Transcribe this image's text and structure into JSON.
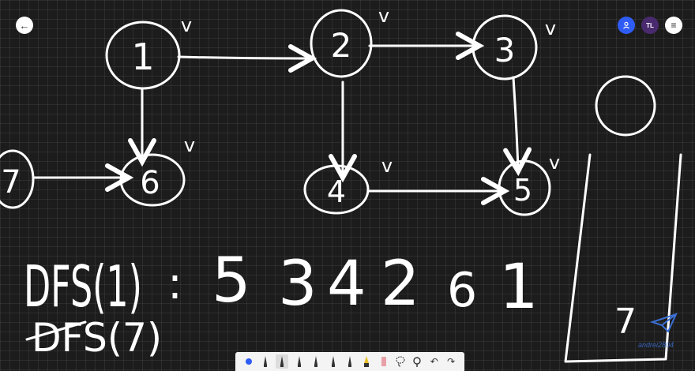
{
  "graph": {
    "nodes": [
      "1",
      "2",
      "3",
      "4",
      "5",
      "6",
      "7"
    ],
    "check_mark": "v"
  },
  "notes": {
    "dfs1_label": "DFS(1)",
    "dfs1_colon": ":",
    "dfs1_sequence": [
      "5",
      "3",
      "4",
      "2",
      "6",
      "1"
    ],
    "dfs7_label": "DFS(7)"
  },
  "stack": {
    "item": "7"
  },
  "header": {
    "user_initials": "TL"
  },
  "toolbar": {
    "tools": [
      "dot-tool",
      "pen-tool",
      "pen-tool",
      "marker-tool",
      "marker-tool",
      "marker-tool",
      "marker-tool",
      "highlighter-tool",
      "eraser-tool",
      "lasso-tool",
      "search-tool",
      "undo-tool",
      "redo-tool"
    ]
  },
  "watermark": {
    "text": "andrei2804"
  },
  "colors": {
    "background": "#1c1c1c",
    "ink": "#ffffff",
    "accent": "#2f5cf5"
  }
}
